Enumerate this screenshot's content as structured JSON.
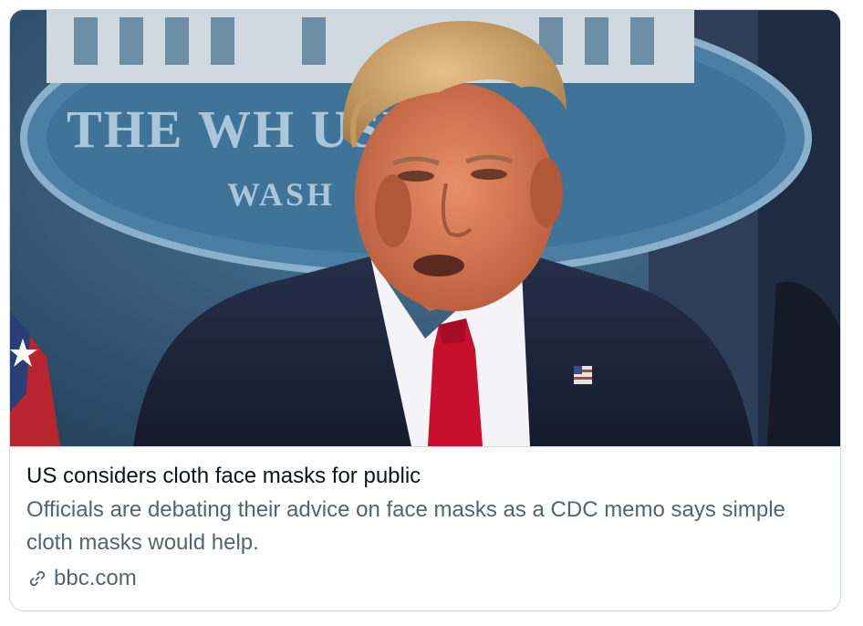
{
  "card": {
    "media_text": "THE WH USE",
    "media_subtext": "WASH",
    "title": "US considers cloth face masks for public",
    "description": "Officials are debating their advice on face masks as a CDC memo says simple cloth masks would help.",
    "domain": "bbc.com",
    "link_icon": "link-icon"
  },
  "colors": {
    "border": "#cfd9de",
    "title": "#0f1419",
    "secondary": "#536471",
    "backdrop": "#3a5a78"
  }
}
